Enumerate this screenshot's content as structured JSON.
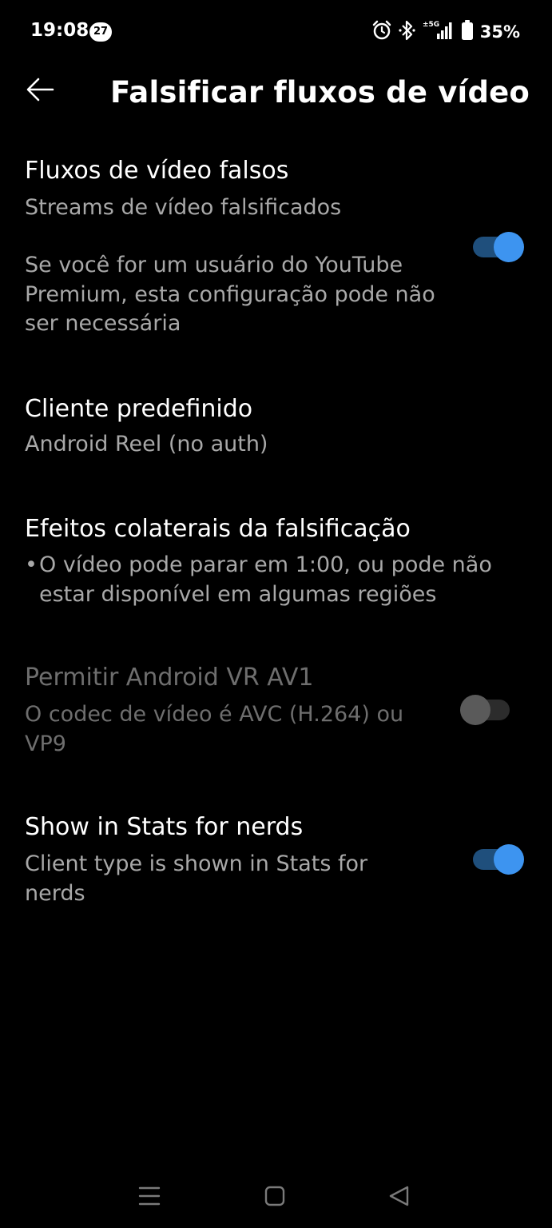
{
  "status_bar": {
    "time": "19:08",
    "notification_count": "27",
    "battery": "35%",
    "icons": [
      "alarm-icon",
      "bluetooth-icon",
      "signal-5g-icon",
      "battery-icon"
    ]
  },
  "app_bar": {
    "back_icon": "arrow-left-icon",
    "title": "Falsificar fluxos de vídeo"
  },
  "settings": [
    {
      "title": "Fluxos de vídeo falsos",
      "subtitle": "Streams de vídeo falsificados",
      "description": "Se você for um usuário do YouTube Premium, esta configuração pode não ser necessária",
      "toggle": true
    },
    {
      "title": "Cliente predefinido",
      "subtitle": "Android Reel (no auth)"
    },
    {
      "title": "Efeitos colaterais da falsificação",
      "bullet": "•",
      "bullet_text": "O vídeo pode parar em 1:00, ou pode não estar disponível em algumas regiões"
    },
    {
      "title": "Permitir Android VR AV1",
      "subtitle": "O codec de vídeo é AVC (H.264) ou VP9",
      "toggle": false,
      "enabled": false
    },
    {
      "title": "Show in Stats for nerds",
      "subtitle": "Client type is shown in Stats for nerds",
      "toggle": true
    }
  ],
  "nav_bar": {
    "icons": [
      "recents-icon",
      "home-icon",
      "back-triangle-icon"
    ]
  },
  "colors": {
    "background": "#000000",
    "primary_text": "#ffffff",
    "secondary_text": "#a8a8a8",
    "disabled_text": "#6e6e6e",
    "toggle_on_thumb": "#3d94f0",
    "toggle_on_track": "#1f4f7c",
    "toggle_off_thumb": "#5a5a5a"
  }
}
